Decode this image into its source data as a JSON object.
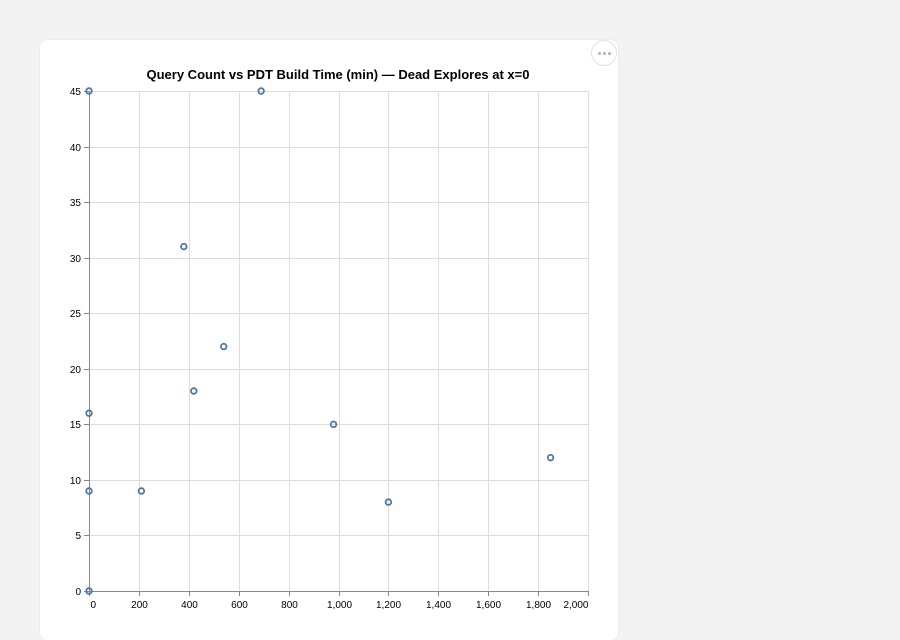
{
  "chart_data": {
    "type": "scatter",
    "title": "Query Count vs PDT Build Time (min) — Dead Explores at x=0",
    "xlabel": "",
    "ylabel": "",
    "xlim": [
      0,
      2000
    ],
    "ylim": [
      0,
      45
    ],
    "x_ticks": [
      0,
      200,
      400,
      600,
      800,
      1000,
      1200,
      1400,
      1600,
      1800,
      2000
    ],
    "x_tick_labels": [
      "0",
      "200",
      "400",
      "600",
      "800",
      "1,000",
      "1,200",
      "1,400",
      "1,600",
      "1,800",
      "2,000"
    ],
    "y_ticks": [
      0,
      5,
      10,
      15,
      20,
      25,
      30,
      35,
      40,
      45
    ],
    "y_tick_labels": [
      "0",
      "5",
      "10",
      "15",
      "20",
      "25",
      "30",
      "35",
      "40",
      "45"
    ],
    "grid": true,
    "marker": "hollow-circle",
    "series": [
      {
        "color": "#4c78a8",
        "points": [
          {
            "x": 0,
            "y": 45
          },
          {
            "x": 0,
            "y": 16
          },
          {
            "x": 0,
            "y": 9
          },
          {
            "x": 0,
            "y": 0
          },
          {
            "x": 210,
            "y": 9
          },
          {
            "x": 380,
            "y": 31
          },
          {
            "x": 420,
            "y": 18
          },
          {
            "x": 540,
            "y": 22
          },
          {
            "x": 690,
            "y": 45
          },
          {
            "x": 980,
            "y": 15
          },
          {
            "x": 1200,
            "y": 8
          },
          {
            "x": 1850,
            "y": 12
          }
        ]
      }
    ]
  },
  "ui": {
    "menu_icon": "more-horizontal-icon"
  }
}
